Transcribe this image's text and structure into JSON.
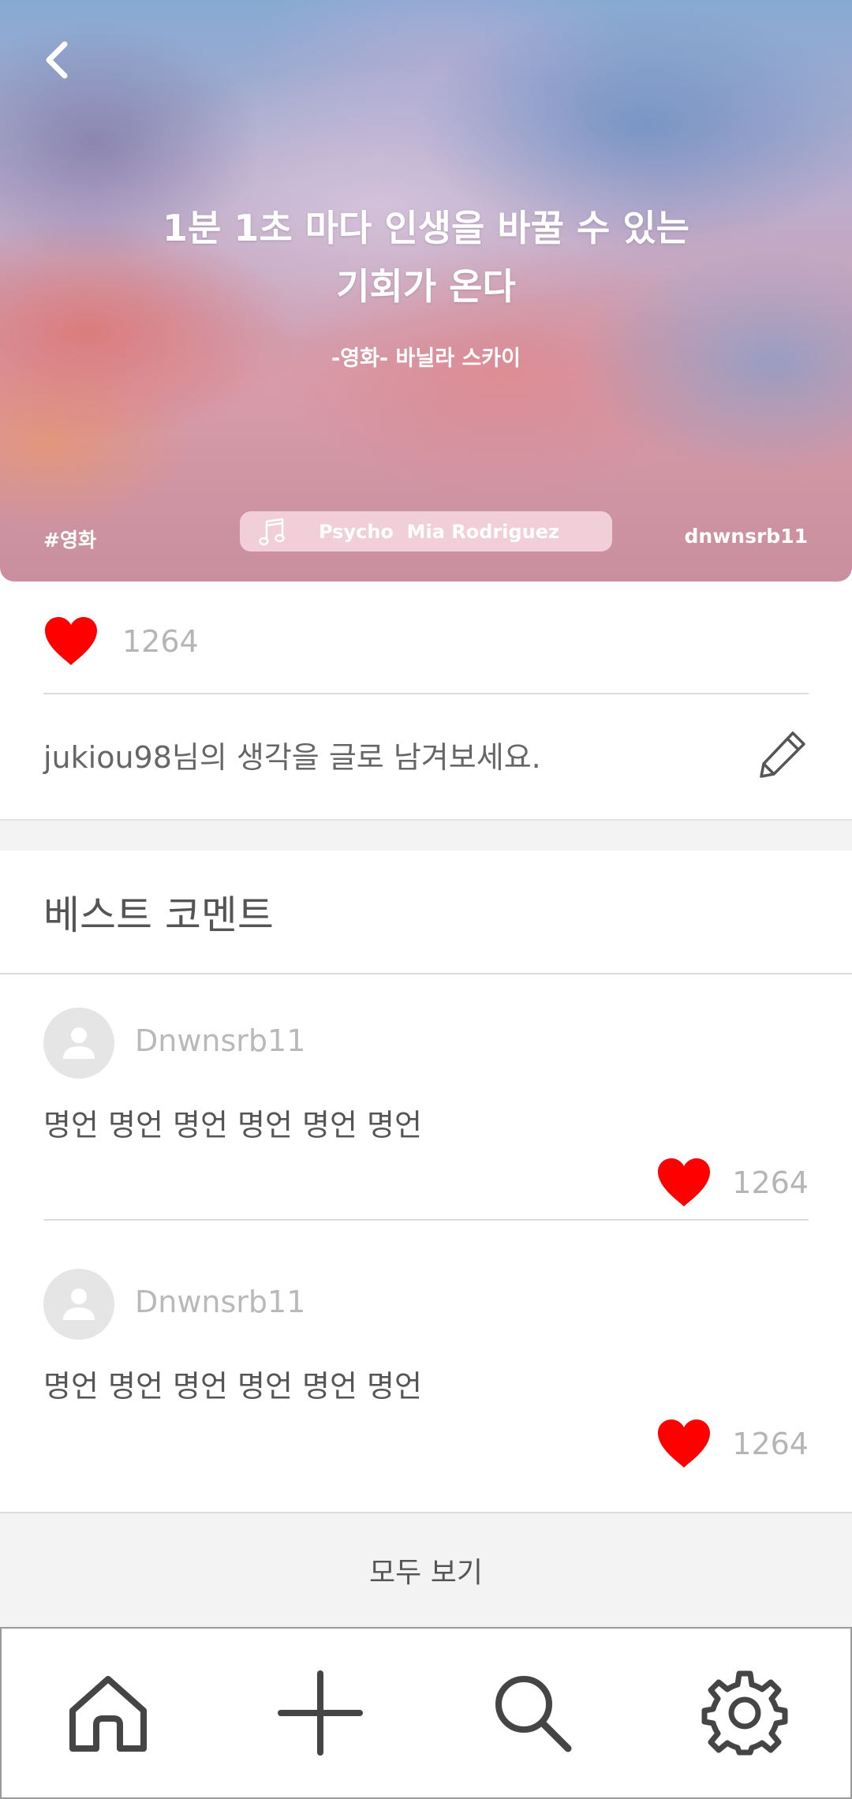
{
  "hero": {
    "quote_line1": "1분 1초 마다 인생을 바꿀 수 있는",
    "quote_line2": "기회가 온다",
    "source": "-영화- 바닐라 스카이",
    "hashtag": "#영화",
    "music": "Psycho  Mia Rodriguez",
    "author": "dnwnsrb11"
  },
  "likes": {
    "count": "1264"
  },
  "write": {
    "prompt": "jukiou98님의 생각을 글로 남겨보세요."
  },
  "best": {
    "title": "베스트 코멘트"
  },
  "comments": [
    {
      "user": "Dnwnsrb11",
      "text": "명언 명언 명언 명언 명언 명언",
      "likes": "1264"
    },
    {
      "user": "Dnwnsrb11",
      "text": "명언 명언 명언 명언 명언 명언",
      "likes": "1264"
    }
  ],
  "see_all": "모두 보기",
  "nav": {
    "icons": [
      "home-icon",
      "plus-icon",
      "search-icon",
      "gear-icon"
    ]
  },
  "colors": {
    "heart": "#ff0000",
    "nav_icon": "#454545",
    "muted_text": "#b5b5b5"
  }
}
